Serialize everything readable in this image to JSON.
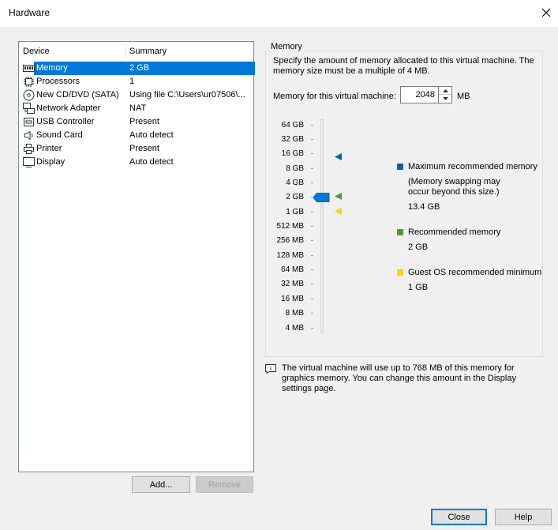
{
  "window": {
    "title": "Hardware"
  },
  "device_list": {
    "headers": {
      "device": "Device",
      "summary": "Summary"
    },
    "rows": [
      {
        "device": "Memory",
        "summary": "2 GB",
        "icon": "memory-icon",
        "selected": true
      },
      {
        "device": "Processors",
        "summary": "1",
        "icon": "processor-icon"
      },
      {
        "device": "New CD/DVD (SATA)",
        "summary": "Using file C:\\Users\\ur07506\\...",
        "icon": "cd-dvd-icon"
      },
      {
        "device": "Network Adapter",
        "summary": "NAT",
        "icon": "network-adapter-icon"
      },
      {
        "device": "USB Controller",
        "summary": "Present",
        "icon": "usb-icon"
      },
      {
        "device": "Sound Card",
        "summary": "Auto detect",
        "icon": "speaker-icon"
      },
      {
        "device": "Printer",
        "summary": "Present",
        "icon": "printer-icon"
      },
      {
        "device": "Display",
        "summary": "Auto detect",
        "icon": "monitor-icon"
      }
    ]
  },
  "buttons": {
    "add": "Add...",
    "remove": "Remove",
    "close": "Close",
    "help": "Help"
  },
  "memory": {
    "group_label": "Memory",
    "description": "Specify the amount of memory allocated to this virtual machine. The memory size must be a multiple of 4 MB.",
    "field_label": "Memory for this virtual machine:",
    "value": "2048",
    "unit": "MB",
    "scale_ticks": [
      "64 GB",
      "32 GB",
      "16 GB",
      "8 GB",
      "4 GB",
      "2 GB",
      "1 GB",
      "512 MB",
      "256 MB",
      "128 MB",
      "64 MB",
      "32 MB",
      "16 MB",
      "8 MB",
      "4 MB"
    ],
    "legend": {
      "max": {
        "label": "Maximum recommended memory",
        "note": "(Memory swapping may occur beyond this size.)",
        "value": "13.4 GB",
        "color": "#0063b1"
      },
      "recommended": {
        "label": "Recommended memory",
        "value": "2 GB",
        "color": "#4c9a2a"
      },
      "guest_min": {
        "label": "Guest OS recommended minimum",
        "value": "1 GB",
        "color": "#ffd400"
      }
    },
    "info": "The virtual machine will use up to 768 MB of this memory for graphics memory. You can change this amount in the Display settings page."
  }
}
